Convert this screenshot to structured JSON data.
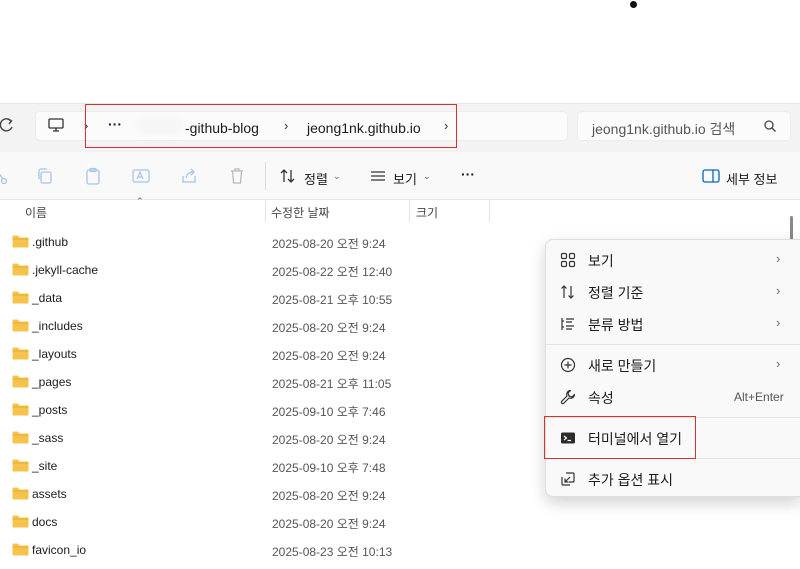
{
  "breadcrumb": {
    "ellipsis": "···",
    "items": [
      "-github-blog",
      "jeong1nk.github.io"
    ],
    "separator": "›"
  },
  "search": {
    "placeholder": "jeong1nk.github.io 검색"
  },
  "toolbar": {
    "sort_label": "정렬",
    "view_label": "보기",
    "more_label": "···",
    "details_label": "세부 정보"
  },
  "columns": {
    "name": "이름",
    "modified": "수정한 날짜",
    "size": "크기"
  },
  "files": [
    {
      "name": ".github",
      "modified": "2025-08-20 오전 9:24"
    },
    {
      "name": ".jekyll-cache",
      "modified": "2025-08-22 오전 12:40"
    },
    {
      "name": "_data",
      "modified": "2025-08-21 오후 10:55"
    },
    {
      "name": "_includes",
      "modified": "2025-08-20 오전 9:24"
    },
    {
      "name": "_layouts",
      "modified": "2025-08-20 오전 9:24"
    },
    {
      "name": "_pages",
      "modified": "2025-08-21 오후 11:05"
    },
    {
      "name": "_posts",
      "modified": "2025-09-10 오후 7:46"
    },
    {
      "name": "_sass",
      "modified": "2025-08-20 오전 9:24"
    },
    {
      "name": "_site",
      "modified": "2025-09-10 오후 7:48"
    },
    {
      "name": "assets",
      "modified": "2025-08-20 오전 9:24"
    },
    {
      "name": "docs",
      "modified": "2025-08-20 오전 9:24"
    },
    {
      "name": "favicon_io",
      "modified": "2025-08-23 오전 10:13"
    }
  ],
  "context_menu": {
    "view": "보기",
    "sort_by": "정렬 기준",
    "group_by": "분류 방법",
    "new": "새로 만들기",
    "properties": "속성",
    "properties_shortcut": "Alt+Enter",
    "open_terminal": "터미널에서 열기",
    "more_options": "추가 옵션 표시",
    "submenu_arrow": "›"
  },
  "colors": {
    "folder": "#f4c34a",
    "highlight": "#d9322a",
    "accent": "#0067c0"
  }
}
